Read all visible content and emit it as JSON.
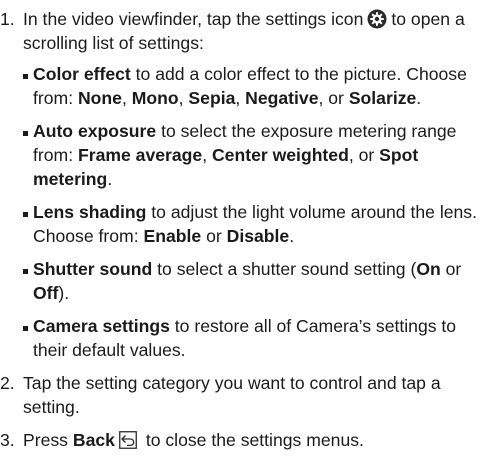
{
  "steps": [
    {
      "num": "1.",
      "text_before_icon": "In the video viewfinder, tap the settings icon",
      "icon": "settings-gear-icon",
      "text_after_icon": "to open a scrolling list of settings:",
      "items": [
        {
          "term": "Color effect",
          "text": " to add a color effect to the picture. Choose from: ",
          "options": [
            "None",
            "Mono",
            "Sepia",
            "Negative",
            "Solarize"
          ],
          "seps": [
            ", ",
            ", ",
            ", ",
            ", or ",
            "."
          ]
        },
        {
          "term": "Auto exposure",
          "text": " to select the exposure metering range from: ",
          "options": [
            "Frame average",
            "Center weighted",
            "Spot metering"
          ],
          "seps": [
            ", ",
            ", or ",
            "."
          ]
        },
        {
          "term": "Lens shading",
          "text": " to adjust the light volume around the lens. Choose from: ",
          "options": [
            "Enable",
            "Disable"
          ],
          "seps": [
            " or ",
            "."
          ]
        },
        {
          "term": "Shutter sound",
          "text": " to select a shutter sound setting (",
          "options": [
            "On",
            "Off"
          ],
          "seps": [
            " or ",
            ")."
          ]
        },
        {
          "term": "Camera settings",
          "text": " to restore all of Camera’s settings to their default values.",
          "options": [],
          "seps": []
        }
      ]
    },
    {
      "num": "2.",
      "text": "Tap the setting category you want to control and tap a setting."
    },
    {
      "num": "3.",
      "text_before": "Press ",
      "bold": "Back",
      "icon": "back-key-icon",
      "text_after": " to close the settings menus."
    }
  ]
}
